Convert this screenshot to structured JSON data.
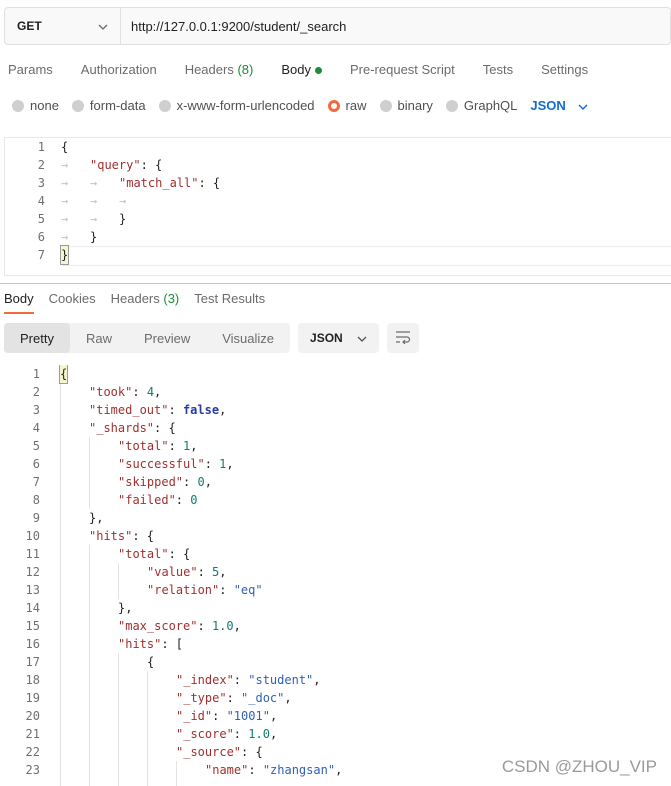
{
  "request": {
    "method": "GET",
    "url": "http://127.0.0.1:9200/student/_search"
  },
  "request_tabs": {
    "params": "Params",
    "authorization": "Authorization",
    "headers": "Headers",
    "headers_count": "(8)",
    "body": "Body",
    "prerequest": "Pre-request Script",
    "tests": "Tests",
    "settings": "Settings"
  },
  "body_types": {
    "none": "none",
    "form_data": "form-data",
    "urlencoded": "x-www-form-urlencoded",
    "raw": "raw",
    "binary": "binary",
    "graphql": "GraphQL",
    "format": "JSON",
    "selected": "raw"
  },
  "request_body": {
    "line_numbers": [
      "1",
      "2",
      "3",
      "4",
      "5",
      "6",
      "7"
    ],
    "l1": "{",
    "l2_key": "\"query\"",
    "l2_rest": ": {",
    "l3_key": "\"match_all\"",
    "l3_rest": ": {",
    "l5": "}",
    "l6": "}",
    "l7": "}"
  },
  "response_tabs": {
    "body": "Body",
    "cookies": "Cookies",
    "headers": "Headers",
    "headers_count": "(3)",
    "test_results": "Test Results"
  },
  "view_modes": {
    "pretty": "Pretty",
    "raw": "Raw",
    "preview": "Preview",
    "visualize": "Visualize",
    "format": "JSON"
  },
  "response_body": {
    "line_numbers": [
      "1",
      "2",
      "3",
      "4",
      "5",
      "6",
      "7",
      "8",
      "9",
      "10",
      "11",
      "12",
      "13",
      "14",
      "15",
      "16",
      "17",
      "18",
      "19",
      "20",
      "21",
      "22",
      "23"
    ],
    "l1": "{",
    "took_key": "\"took\"",
    "took_val": "4",
    "timed_out_key": "\"timed_out\"",
    "timed_out_val": "false",
    "shards_key": "\"_shards\"",
    "total_key": "\"total\"",
    "total_val": "1",
    "successful_key": "\"successful\"",
    "successful_val": "1",
    "skipped_key": "\"skipped\"",
    "skipped_val": "0",
    "failed_key": "\"failed\"",
    "failed_val": "0",
    "hits_key": "\"hits\"",
    "hits_total_key": "\"total\"",
    "value_key": "\"value\"",
    "value_val": "5",
    "relation_key": "\"relation\"",
    "relation_val": "\"eq\"",
    "max_score_key": "\"max_score\"",
    "max_score_val": "1.0",
    "hits_arr_key": "\"hits\"",
    "index_key": "\"_index\"",
    "index_val": "\"student\"",
    "type_key": "\"_type\"",
    "type_val": "\"_doc\"",
    "id_key": "\"_id\"",
    "id_val": "\"1001\"",
    "score_key": "\"_score\"",
    "score_val": "1.0",
    "source_key": "\"_source\"",
    "name_key": "\"name\"",
    "name_val": "\"zhangsan\""
  },
  "watermark": "CSDN @ZHOU_VIP"
}
